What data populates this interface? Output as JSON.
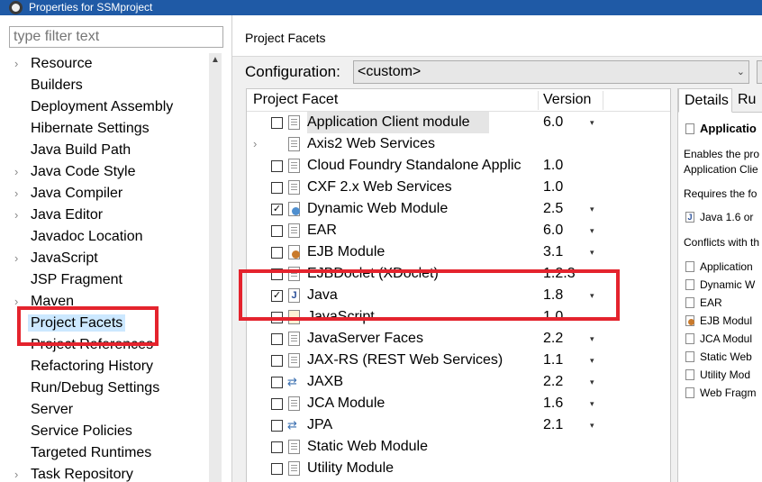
{
  "window": {
    "title": "Properties for SSMproject"
  },
  "filter": {
    "placeholder": "type filter text"
  },
  "nav": {
    "items": [
      {
        "label": "Resource",
        "expandable": true
      },
      {
        "label": "Builders",
        "expandable": false
      },
      {
        "label": "Deployment Assembly",
        "expandable": false
      },
      {
        "label": "Hibernate Settings",
        "expandable": false
      },
      {
        "label": "Java Build Path",
        "expandable": false
      },
      {
        "label": "Java Code Style",
        "expandable": true
      },
      {
        "label": "Java Compiler",
        "expandable": true
      },
      {
        "label": "Java Editor",
        "expandable": true
      },
      {
        "label": "Javadoc Location",
        "expandable": false
      },
      {
        "label": "JavaScript",
        "expandable": true
      },
      {
        "label": "JSP Fragment",
        "expandable": false
      },
      {
        "label": "Maven",
        "expandable": true
      },
      {
        "label": "Project Facets",
        "expandable": false,
        "selected": true
      },
      {
        "label": "Project References",
        "expandable": false
      },
      {
        "label": "Refactoring History",
        "expandable": false
      },
      {
        "label": "Run/Debug Settings",
        "expandable": false
      },
      {
        "label": "Server",
        "expandable": false
      },
      {
        "label": "Service Policies",
        "expandable": false
      },
      {
        "label": "Targeted Runtimes",
        "expandable": false
      },
      {
        "label": "Task Repository",
        "expandable": true
      }
    ]
  },
  "page": {
    "title": "Project Facets",
    "configuration_label": "Configuration:",
    "configuration_value": "<custom>"
  },
  "facets": {
    "col_facet": "Project Facet",
    "col_version": "Version",
    "rows": [
      {
        "name": "Application Client module",
        "version": "6.0",
        "checked": false,
        "icon": "doc",
        "dropdown": true,
        "highlight": true
      },
      {
        "name": "Axis2 Web Services",
        "version": "",
        "checked": null,
        "icon": "doc",
        "dropdown": false,
        "expandable": true
      },
      {
        "name": "Cloud Foundry Standalone Applic",
        "version": "1.0",
        "checked": false,
        "icon": "doc",
        "dropdown": false
      },
      {
        "name": "CXF 2.x Web Services",
        "version": "1.0",
        "checked": false,
        "icon": "doc",
        "dropdown": false
      },
      {
        "name": "Dynamic Web Module",
        "version": "2.5",
        "checked": true,
        "icon": "web",
        "dropdown": true
      },
      {
        "name": "EAR",
        "version": "6.0",
        "checked": false,
        "icon": "doc",
        "dropdown": true
      },
      {
        "name": "EJB Module",
        "version": "3.1",
        "checked": false,
        "icon": "bean",
        "dropdown": true
      },
      {
        "name": "EJBDoclet (XDoclet)",
        "version": "1.2.3",
        "checked": false,
        "icon": "doc",
        "dropdown": false
      },
      {
        "name": "Java",
        "version": "1.8",
        "checked": true,
        "icon": "java",
        "dropdown": true
      },
      {
        "name": "JavaScript",
        "version": "1.0",
        "checked": false,
        "icon": "js",
        "dropdown": false
      },
      {
        "name": "JavaServer Faces",
        "version": "2.2",
        "checked": false,
        "icon": "doc",
        "dropdown": true
      },
      {
        "name": "JAX-RS (REST Web Services)",
        "version": "1.1",
        "checked": false,
        "icon": "doc",
        "dropdown": true
      },
      {
        "name": "JAXB",
        "version": "2.2",
        "checked": false,
        "icon": "arrows",
        "dropdown": true
      },
      {
        "name": "JCA Module",
        "version": "1.6",
        "checked": false,
        "icon": "doc",
        "dropdown": true
      },
      {
        "name": "JPA",
        "version": "2.1",
        "checked": false,
        "icon": "arrows",
        "dropdown": true
      },
      {
        "name": "Static Web Module",
        "version": "",
        "checked": false,
        "icon": "doc",
        "dropdown": false
      },
      {
        "name": "Utility Module",
        "version": "",
        "checked": false,
        "icon": "doc",
        "dropdown": false
      }
    ]
  },
  "details": {
    "tab_details": "Details",
    "tab_runtimes": "Ru",
    "heading": "Applicatio",
    "desc_line1": "Enables the pro",
    "desc_line2": "Application Clie",
    "requires_label": "Requires the fo",
    "requires_item": "Java 1.6 or",
    "conflicts_label": "Conflicts with th",
    "conflicts": [
      {
        "label": "Application",
        "icon": "doc"
      },
      {
        "label": "Dynamic W",
        "icon": "doc"
      },
      {
        "label": "EAR",
        "icon": "doc"
      },
      {
        "label": "EJB Modul",
        "icon": "bean"
      },
      {
        "label": "JCA Modul",
        "icon": "doc"
      },
      {
        "label": "Static Web",
        "icon": "doc"
      },
      {
        "label": "Utility Mod",
        "icon": "doc"
      },
      {
        "label": "Web Fragm",
        "icon": "doc"
      }
    ]
  },
  "colors": {
    "titlebar": "#1f5aa6",
    "selection": "#cce8ff",
    "annotation_red": "#e4232d"
  }
}
